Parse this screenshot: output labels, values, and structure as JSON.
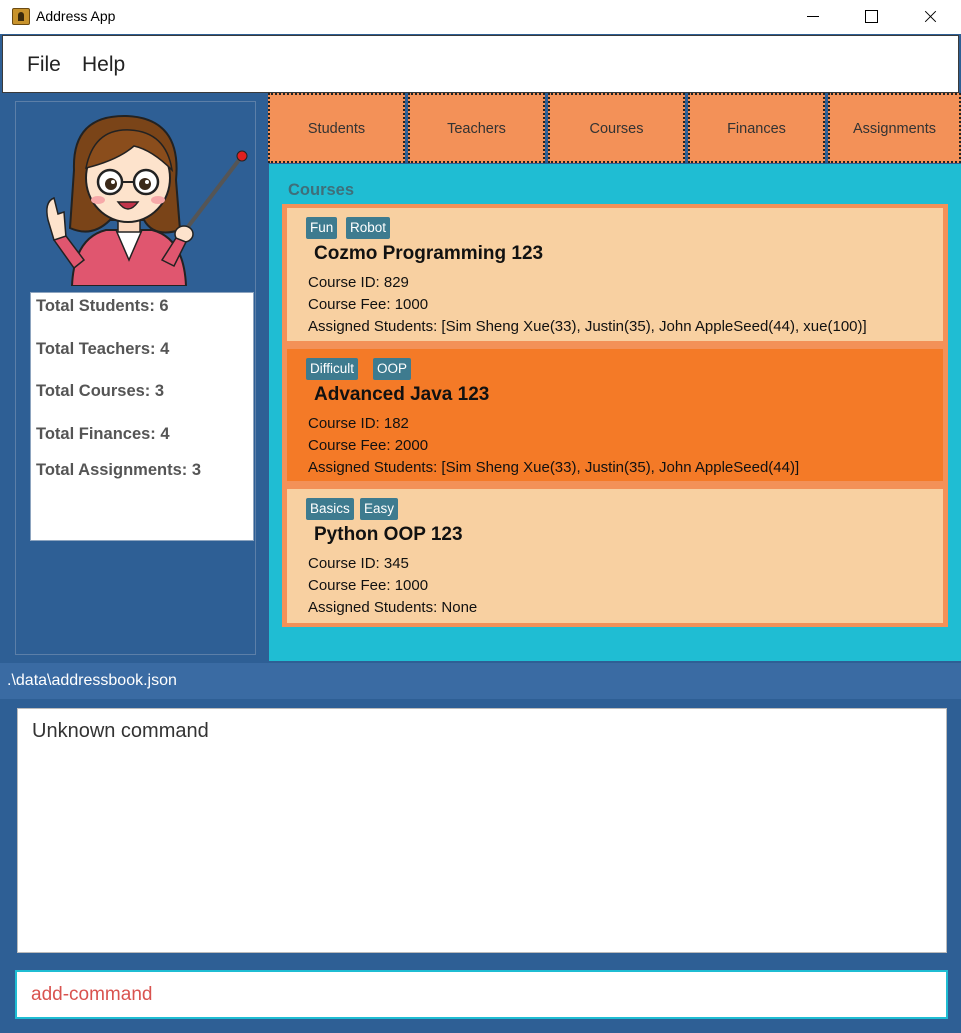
{
  "window": {
    "title": "Address App"
  },
  "menu": {
    "items": [
      "File",
      "Help"
    ]
  },
  "sidebar": {
    "stats": [
      "Total Students: 6",
      "Total Teachers: 4",
      "Total Courses: 3",
      "Total Finances: 4",
      "Total Assignments: 3"
    ]
  },
  "tabs": [
    "Students",
    "Teachers",
    "Courses",
    "Finances",
    "Assignments"
  ],
  "panel": {
    "title": "Courses",
    "courses": [
      {
        "tags": [
          "Fun",
          "Robot"
        ],
        "name": "Cozmo Programming 123",
        "id": "Course ID: 829",
        "fee": "Course Fee: 1000",
        "students": "Assigned Students: [Sim Sheng Xue(33), Justin(35), John AppleSeed(44), xue(100)]"
      },
      {
        "tags": [
          "Difficult",
          "OOP"
        ],
        "name": "Advanced Java 123",
        "id": "Course ID: 182",
        "fee": "Course Fee: 2000",
        "students": "Assigned Students: [Sim Sheng Xue(33), Justin(35), John AppleSeed(44)]"
      },
      {
        "tags": [
          "Basics",
          "Easy"
        ],
        "name": "Python OOP 123",
        "id": "Course ID: 345",
        "fee": "Course Fee: 1000",
        "students": "Assigned Students: None"
      }
    ]
  },
  "status": {
    "path": ".\\data\\addressbook.json"
  },
  "result": {
    "text": "Unknown command"
  },
  "command": {
    "value": "add-command"
  },
  "colors": {
    "window_bg": "#2e5f95",
    "tab_bg": "#f39158",
    "panel_bg": "#1fbdd3",
    "card_bg": "#f8d0a1",
    "card_selected_bg": "#f47a27",
    "tag_bg": "#3e7b8f",
    "command_text": "#d9534f"
  },
  "icons": {
    "app": "address-book-icon",
    "window_controls": [
      "minimize-icon",
      "maximize-icon",
      "close-icon"
    ],
    "illustration": "teacher-with-pointer-illustration"
  }
}
